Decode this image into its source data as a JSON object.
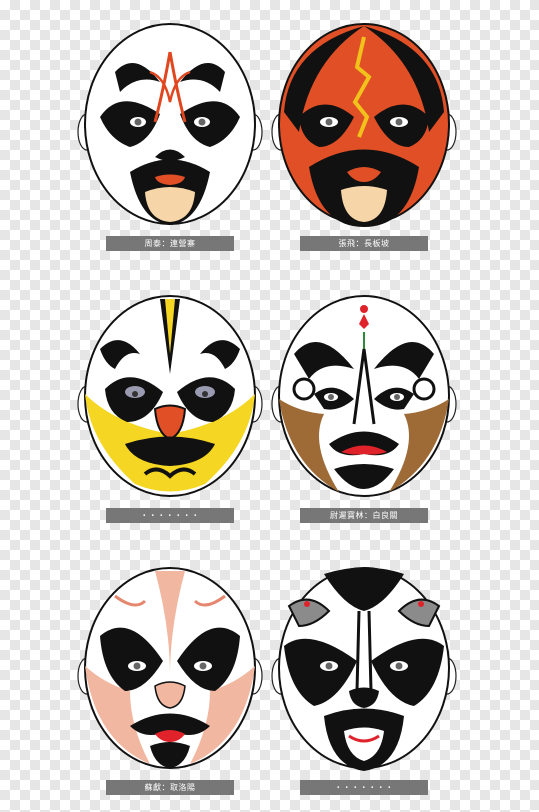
{
  "masks": [
    {
      "caption": "周泰：連營寨",
      "paint": "#ffffff",
      "accent": "#e0471f",
      "secondary": "#000000"
    },
    {
      "caption": "張飛：長板坡",
      "paint": "#e14f26",
      "accent": "#f1c21b",
      "secondary": "#000000"
    },
    {
      "caption": "・・・・・・・",
      "paint": "#f4d623",
      "accent": "#ffffff",
      "secondary": "#9a9ab0"
    },
    {
      "caption": "尉遲寶林：白良關",
      "paint": "#9e6b37",
      "accent": "#e0222a",
      "secondary": "#ffffff"
    },
    {
      "caption": "蘇獻：取洛陽",
      "paint": "#f2b7a0",
      "accent": "#e5876e",
      "secondary": "#000000"
    },
    {
      "caption": "・・・・・・・",
      "paint": "#ffffff",
      "accent": "#8b8b8b",
      "secondary": "#000000"
    }
  ]
}
